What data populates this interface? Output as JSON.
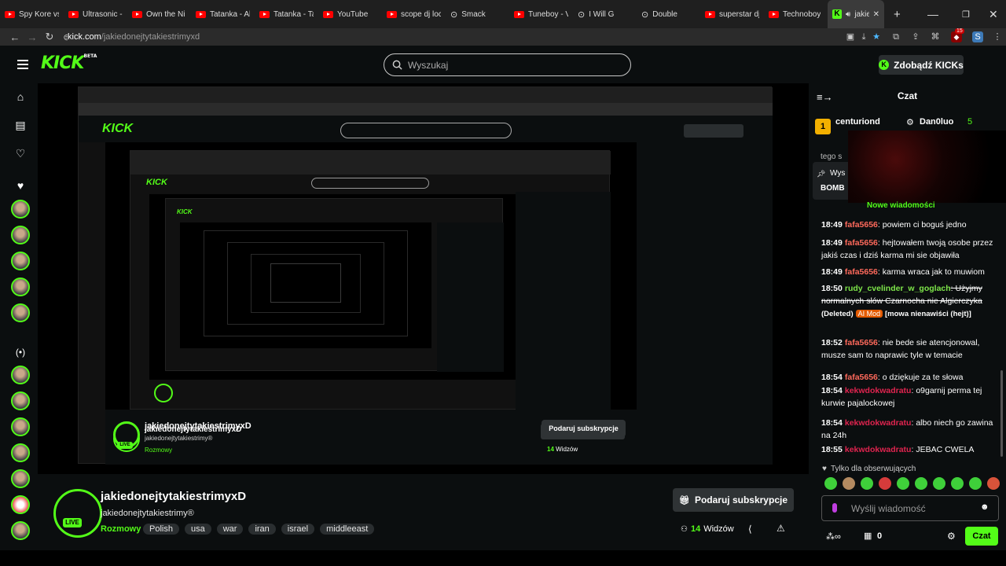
{
  "browser": {
    "tabs": [
      {
        "label": "Spy Kore vs",
        "icon": "youtube-icon"
      },
      {
        "label": "Ultrasonic -",
        "icon": "youtube-icon"
      },
      {
        "label": "Own the Ni",
        "icon": "youtube-icon"
      },
      {
        "label": "Tatanka - Al",
        "icon": "youtube-icon"
      },
      {
        "label": "Tatanka - Ta",
        "icon": "youtube-icon"
      },
      {
        "label": "YouTube",
        "icon": "youtube-icon"
      },
      {
        "label": "scope dj loc",
        "icon": "youtube-icon"
      },
      {
        "label": "Smack",
        "icon": "music-icon"
      },
      {
        "label": "Tuneboy - V",
        "icon": "youtube-icon"
      },
      {
        "label": "I Will G",
        "icon": "music-icon"
      },
      {
        "label": "Double",
        "icon": "music-icon"
      },
      {
        "label": "superstar dj",
        "icon": "youtube-icon"
      },
      {
        "label": "Technoboy",
        "icon": "youtube-icon"
      }
    ],
    "active_tab": {
      "label": "jakie",
      "close": "✕"
    },
    "new_tab": "+",
    "url_host": "kick.com",
    "url_path": "/jakiedonejtytakiestrimyxd",
    "extension_badge": "15"
  },
  "header": {
    "logo": "KICK",
    "logo_badge": "BETA",
    "search_placeholder": "Wyszukaj",
    "kicks_button": "Zdobądź KICKs"
  },
  "channel": {
    "name": "jakiedonejtytakiestrimyxD",
    "username": "jakiedonejtytakiestrimy®",
    "live": "LIVE",
    "category": "Rozmowy",
    "tags": [
      "Polish",
      "usa",
      "war",
      "iran",
      "israel",
      "middleeast"
    ],
    "subscribe_button": "Podaruj subskrypcje",
    "viewers": "14",
    "viewers_label": "Widzów"
  },
  "chat": {
    "title": "Czat",
    "pinned_user1": "centuriond",
    "pinned_user2": "Dan0luo",
    "pinned_count": "5",
    "pinned_partial1": "tego s",
    "pinned_partial2": "Wys",
    "pinned_partial3": "BOMB",
    "new_messages": "Nowe wiadomości",
    "messages": [
      {
        "time": "18:49",
        "user": "fafa5656",
        "ucls": "u1",
        "text": ": powiem ci boguś jedno"
      },
      {
        "time": "18:49",
        "user": "fafa5656",
        "ucls": "u1",
        "text": ": hejtowałem twoją osobe przez jakiś czas i dziś karma mi sie objawiła"
      },
      {
        "time": "18:49",
        "user": "fafa5656",
        "ucls": "u1",
        "text": ": karma wraca jak to muwiom"
      },
      {
        "time": "18:50",
        "user": "rudy_cvelinder_w_goglach",
        "ucls": "u2",
        "text": ": Użyjmy normalnych słów Czarnocha nie Algierczyka",
        "deleted": "(Deleted)",
        "mod_badge": "AI Mod",
        "reason": "[mowa nienawiści (hejt)]"
      },
      {
        "time": "18:52",
        "user": "fafa5656",
        "ucls": "u1",
        "text": ": nie bede sie atencjonowal, musze sam to naprawic tyle w temacie"
      },
      {
        "time": "18:54",
        "user": "fafa5656",
        "ucls": "u1",
        "text": ": o dziękuje za te słowa"
      },
      {
        "time": "18:54",
        "user": "kekwdokwadratu",
        "ucls": "u3",
        "text": ": o9garnij perma tej kurwie pajalockowej"
      },
      {
        "time": "18:54",
        "user": "kekwdokwadratu",
        "ucls": "u3",
        "text": ": albo niech go zawina na 24h"
      },
      {
        "time": "18:55",
        "user": "kekwdokwadratu",
        "ucls": "u3",
        "text": ": JEBAC CWELA"
      }
    ],
    "followers_only": "Tylko dla obserwujących",
    "input_placeholder": "Wyślij wiadomość",
    "points": "0",
    "send_button": "Czat"
  },
  "colors": {
    "accent": "#53fc18",
    "background": "#0b0e0f",
    "chrome": "#1f1f1f"
  }
}
